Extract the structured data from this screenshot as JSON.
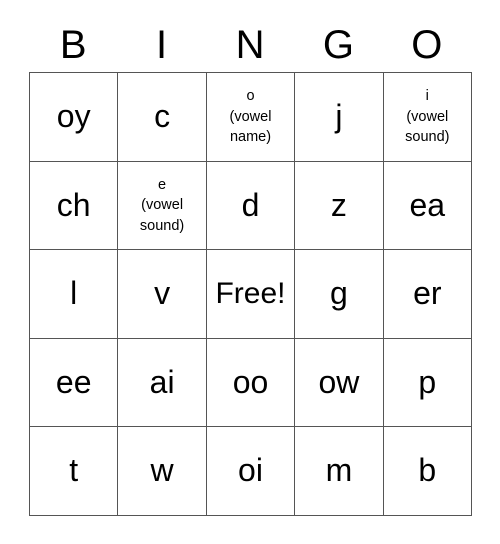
{
  "card": {
    "title": "BINGO",
    "headers": [
      "B",
      "I",
      "N",
      "G",
      "O"
    ],
    "free_space_label": "Free!",
    "border_color": "#555555",
    "text_color": "#000000",
    "background_color": "#ffffff",
    "rows": [
      [
        {
          "text": "oy",
          "size": "large"
        },
        {
          "text": "c",
          "size": "large"
        },
        {
          "text": "o\n(vowel\nname)",
          "size": "small"
        },
        {
          "text": "j",
          "size": "large"
        },
        {
          "text": "i\n(vowel\nsound)",
          "size": "small"
        }
      ],
      [
        {
          "text": "ch",
          "size": "large"
        },
        {
          "text": "e\n(vowel\nsound)",
          "size": "small"
        },
        {
          "text": "d",
          "size": "large"
        },
        {
          "text": "z",
          "size": "large"
        },
        {
          "text": "ea",
          "size": "large"
        }
      ],
      [
        {
          "text": "l",
          "size": "large"
        },
        {
          "text": "v",
          "size": "large"
        },
        {
          "text": "Free!",
          "size": "free"
        },
        {
          "text": "g",
          "size": "large"
        },
        {
          "text": "er",
          "size": "large"
        }
      ],
      [
        {
          "text": "ee",
          "size": "large"
        },
        {
          "text": "ai",
          "size": "large"
        },
        {
          "text": "oo",
          "size": "large"
        },
        {
          "text": "ow",
          "size": "large"
        },
        {
          "text": "p",
          "size": "large"
        }
      ],
      [
        {
          "text": "t",
          "size": "large"
        },
        {
          "text": "w",
          "size": "large"
        },
        {
          "text": "oi",
          "size": "large"
        },
        {
          "text": "m",
          "size": "large"
        },
        {
          "text": "b",
          "size": "large"
        }
      ]
    ]
  }
}
